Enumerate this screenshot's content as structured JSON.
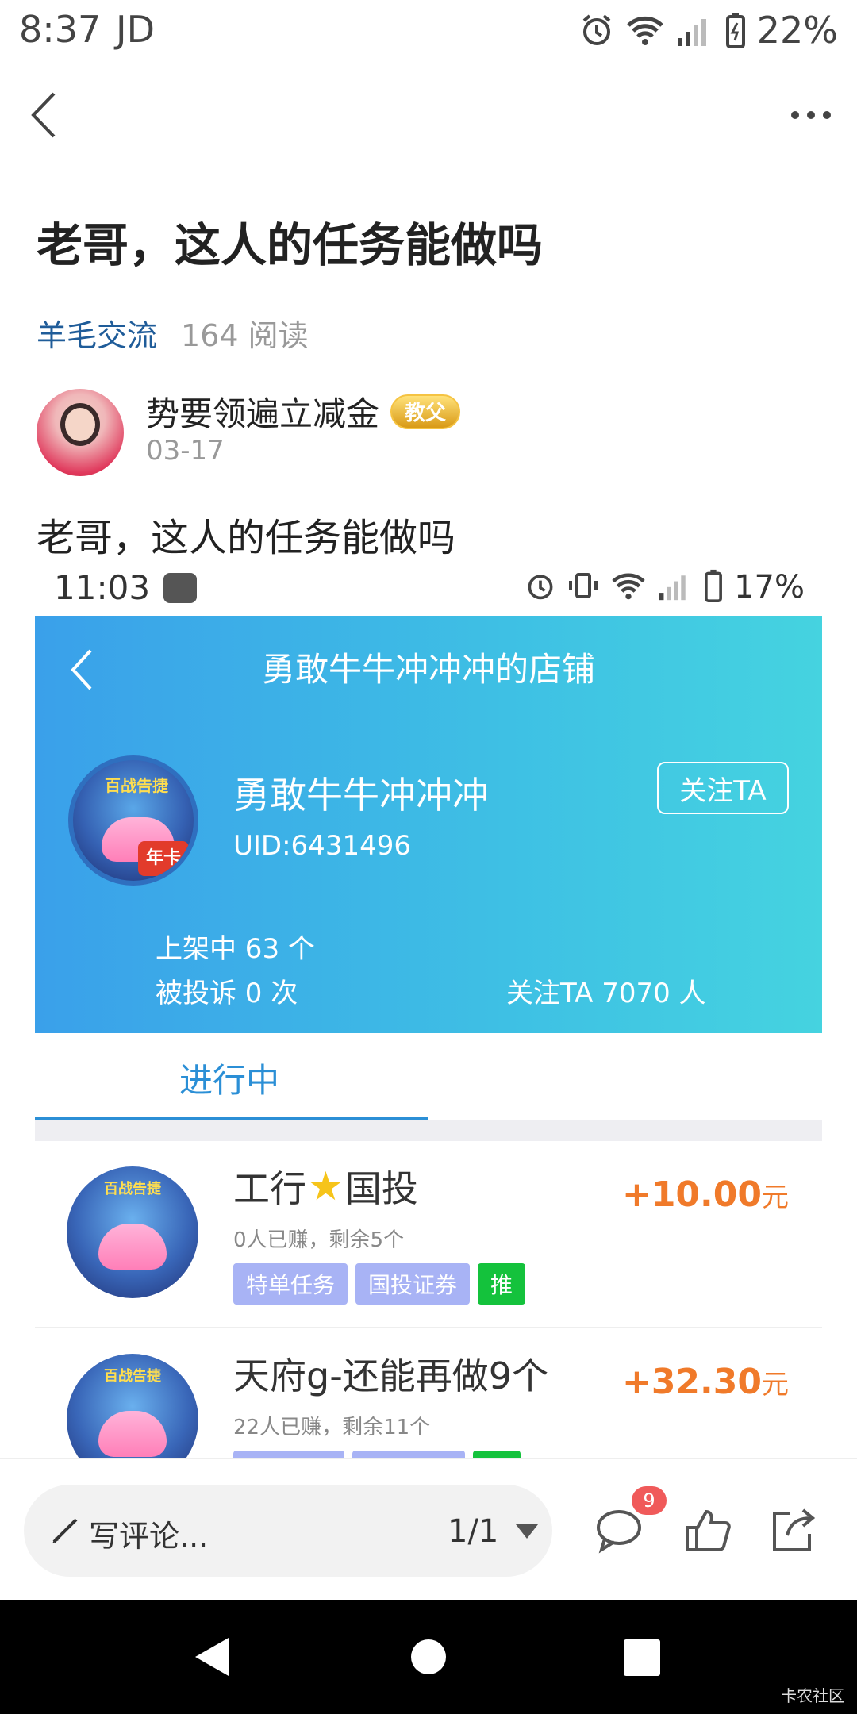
{
  "status_bar": {
    "time": "8:37",
    "carrier": "JD",
    "battery_pct": "22%"
  },
  "post": {
    "title": "老哥，这人的任务能做吗",
    "category": "羊毛交流",
    "reads": "164 阅读",
    "author": {
      "name": "势要领遍立减金",
      "badge": "教父",
      "date": "03-17"
    },
    "body": "老哥，这人的任务能做吗"
  },
  "embedded": {
    "status_bar": {
      "time": "11:03",
      "battery_pct": "17%"
    },
    "shop": {
      "header_title": "勇敢牛牛冲冲冲的店铺",
      "avatar_banner": "百战告捷",
      "avatar_tag": "年卡",
      "name": "勇敢牛牛冲冲冲",
      "uid": "UID:6431496",
      "follow_button": "关注TA",
      "listed": "上架中 63 个",
      "complaints": "被投诉 0 次",
      "followers": "关注TA 7070 人"
    },
    "tabs": {
      "active": "进行中"
    },
    "tasks": [
      {
        "name_before": "工行",
        "name_after": "国投",
        "earned": "0人已赚，剩余5个",
        "tags": [
          "特单任务",
          "国投证券",
          "推"
        ],
        "price": "+10.00",
        "unit": "元",
        "avatar_banner": "百战告捷"
      },
      {
        "name_before": "天府g-还能再做9个",
        "name_after": "",
        "earned": "22人已赚，剩余11个",
        "tags": [
          "",
          "",
          ""
        ],
        "price": "+32.30",
        "unit": "元",
        "avatar_banner": "百战告捷"
      }
    ]
  },
  "comment_bar": {
    "placeholder": "写评论...",
    "page": "1/1",
    "comment_count": "9"
  },
  "watermark": "卡农社区",
  "colors": {
    "shop_gradient_start": "#3aa0ea",
    "shop_gradient_end": "#45d3e0",
    "price": "#f07a2a",
    "tab_active": "#2b8fd6",
    "tag_bg": "#a8b3f5",
    "tag_green": "#14c23c"
  }
}
